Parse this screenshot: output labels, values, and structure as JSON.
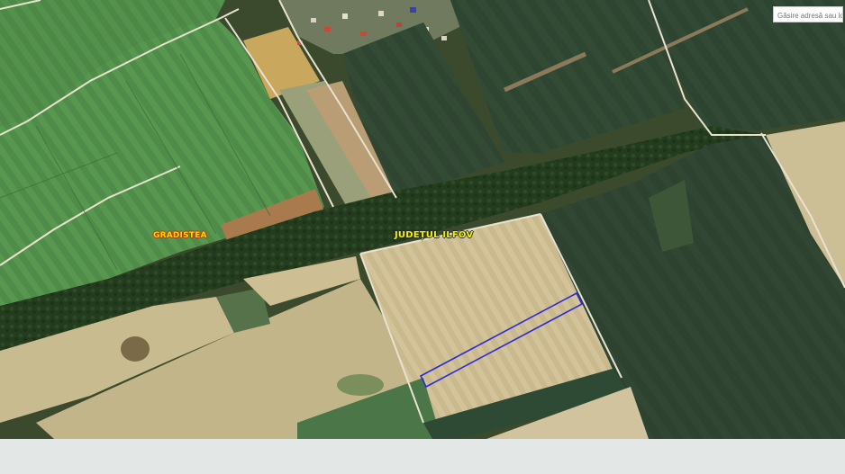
{
  "map": {
    "search": {
      "placeholder": "Găsire adresă sau loc"
    },
    "labels": {
      "locality": "GRADISTEA",
      "county": "JUDEȚUL ILFOV"
    },
    "colors": {
      "parcel_outline": "#2b2bd6",
      "locality_label": "#ffd400",
      "county_label": "#f3f300",
      "forest": "#243c1e"
    }
  }
}
